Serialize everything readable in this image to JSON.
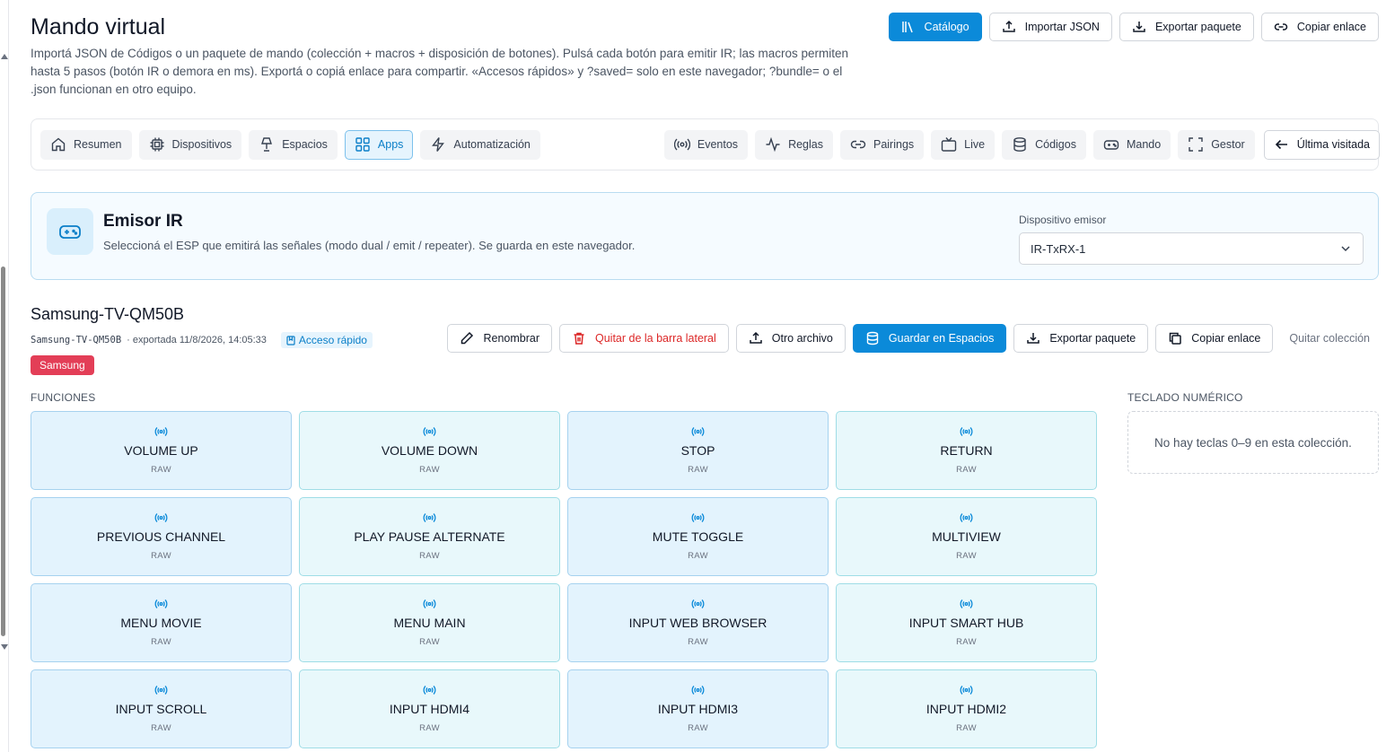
{
  "page": {
    "title": "Mando virtual",
    "description": "Importá JSON de Códigos o un paquete de mando (colección + macros + disposición de botones). Pulsá cada botón para emitir IR; las macros permiten hasta 5 pasos (botón IR o demora en ms). Exportá o copiá enlace para compartir. «Accesos rápidos» y ?saved= solo en este navegador; ?bundle= o el .json funcionan en otro equipo."
  },
  "top_actions": [
    {
      "label": "Catálogo",
      "icon": "library-icon",
      "primary": true
    },
    {
      "label": "Importar JSON",
      "icon": "upload-icon"
    },
    {
      "label": "Exportar paquete",
      "icon": "download-icon"
    },
    {
      "label": "Copiar enlace",
      "icon": "link-icon"
    }
  ],
  "nav": {
    "items": [
      {
        "label": "Resumen",
        "icon": "home-icon"
      },
      {
        "label": "Dispositivos",
        "icon": "chip-icon"
      },
      {
        "label": "Espacios",
        "icon": "lamp-icon"
      },
      {
        "label": "Apps",
        "icon": "grid-icon",
        "active": true
      },
      {
        "label": "Automatización",
        "icon": "bolt-icon"
      },
      {
        "label": "Eventos",
        "icon": "radio-icon"
      },
      {
        "label": "Reglas",
        "icon": "activity-icon"
      },
      {
        "label": "Pairings",
        "icon": "link-icon"
      },
      {
        "label": "Live",
        "icon": "tv-icon"
      },
      {
        "label": "Códigos",
        "icon": "database-icon"
      },
      {
        "label": "Mando",
        "icon": "gamepad-icon"
      },
      {
        "label": "Gestor",
        "icon": "scan-icon"
      }
    ],
    "back_label": "Última visitada"
  },
  "emitter": {
    "title": "Emisor IR",
    "subtitle": "Seleccioná el ESP que emitirá las señales (modo dual / emit / repeater). Se guarda en este navegador.",
    "select_label": "Dispositivo emisor",
    "selected": "IR-TxRX-1"
  },
  "collection": {
    "name": "Samsung-TV-QM50B",
    "id": "Samsung-TV-QM50B",
    "exported": "· exportada 11/8/2026, 14:05:33",
    "quick_access": "Acceso rápido",
    "brand": "Samsung",
    "actions": [
      {
        "label": "Renombrar",
        "icon": "pencil-icon"
      },
      {
        "label": "Quitar de la barra lateral",
        "icon": "trash-icon",
        "danger": true
      },
      {
        "label": "Otro archivo",
        "icon": "upload-icon"
      },
      {
        "label": "Guardar en Espacios",
        "icon": "database-icon",
        "primary": true
      },
      {
        "label": "Exportar paquete",
        "icon": "download-icon"
      },
      {
        "label": "Copiar enlace",
        "icon": "copy-icon"
      },
      {
        "label": "Quitar colección",
        "link": true
      }
    ]
  },
  "functions": {
    "label": "FUNCIONES",
    "keys": [
      {
        "name": "VOLUME UP",
        "type": "RAW"
      },
      {
        "name": "VOLUME DOWN",
        "type": "RAW"
      },
      {
        "name": "STOP",
        "type": "RAW"
      },
      {
        "name": "RETURN",
        "type": "RAW"
      },
      {
        "name": "PREVIOUS CHANNEL",
        "type": "RAW"
      },
      {
        "name": "PLAY PAUSE ALTERNATE",
        "type": "RAW"
      },
      {
        "name": "MUTE TOGGLE",
        "type": "RAW"
      },
      {
        "name": "MULTIVIEW",
        "type": "RAW"
      },
      {
        "name": "MENU MOVIE",
        "type": "RAW"
      },
      {
        "name": "MENU MAIN",
        "type": "RAW"
      },
      {
        "name": "INPUT WEB BROWSER",
        "type": "RAW"
      },
      {
        "name": "INPUT SMART HUB",
        "type": "RAW"
      },
      {
        "name": "INPUT SCROLL",
        "type": "RAW"
      },
      {
        "name": "INPUT HDMI4",
        "type": "RAW"
      },
      {
        "name": "INPUT HDMI3",
        "type": "RAW"
      },
      {
        "name": "INPUT HDMI2",
        "type": "RAW"
      }
    ]
  },
  "numpad": {
    "label": "TECLADO NUMÉRICO",
    "empty": "No hay teclas 0–9 en esta colección."
  },
  "colors": {
    "primary": "#0b8ad9",
    "danger": "#dc2626",
    "brand_badge": "#e33e57",
    "key_bg": "#e8f8fb",
    "key_bg_alt": "#e3f3fd"
  }
}
